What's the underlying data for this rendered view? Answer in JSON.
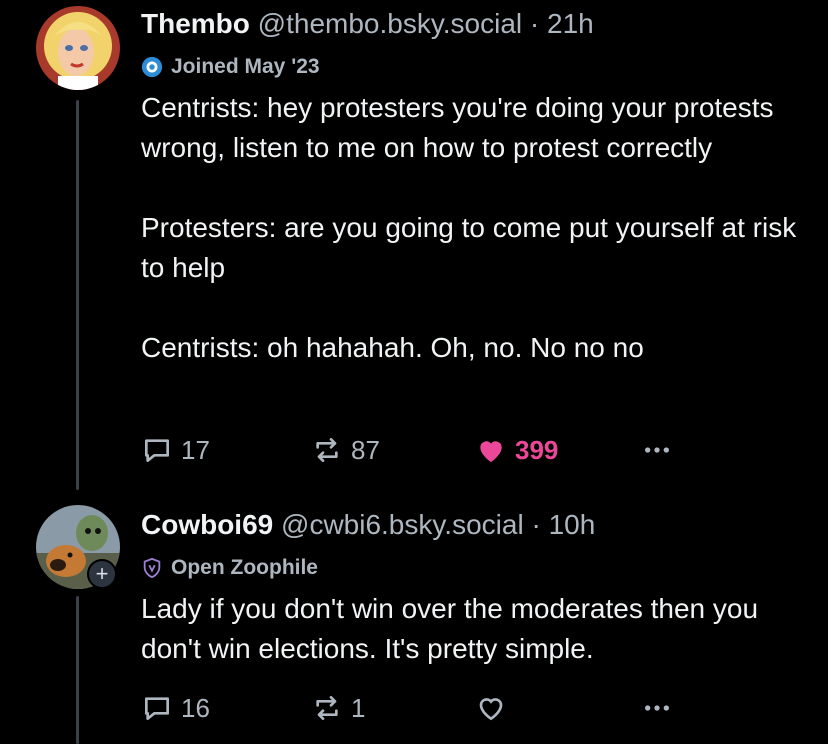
{
  "posts": [
    {
      "author": {
        "display_name": "Thembo",
        "handle": "@thembo.bsky.social",
        "time": "21h",
        "avatar_icon": "cartoon-blonde-woman-avatar"
      },
      "badge": {
        "icon": "bluesky-verified-badge-icon",
        "text": "Joined May '23"
      },
      "text": "Centrists: hey protesters you're doing your protests wrong, listen to me on how to protest correctly\n\nProtesters: are you going to come put yourself at risk to help\n\nCentrists: oh hahahah. Oh, no. No no no",
      "actions": {
        "replies": "17",
        "reposts": "87",
        "likes": "399",
        "liked": true
      }
    },
    {
      "author": {
        "display_name": "Cowboi69",
        "handle": "@cwbi6.bsky.social",
        "time": "10h",
        "avatar_icon": "dog-and-character-avatar"
      },
      "badge": {
        "icon": "shield-label-icon",
        "text": "Open Zoophile"
      },
      "follow_badge": "+",
      "text": "Lady if you don't win over the moderates then you don't win elections. It's pretty simple.",
      "actions": {
        "replies": "16",
        "reposts": "1",
        "likes": "",
        "liked": false
      }
    }
  ],
  "separator": "·",
  "colors": {
    "background": "#000000",
    "text": "#f1f3f5",
    "muted": "#aeb6bf",
    "like": "#ec4899",
    "thread_line": "#3a4148"
  }
}
